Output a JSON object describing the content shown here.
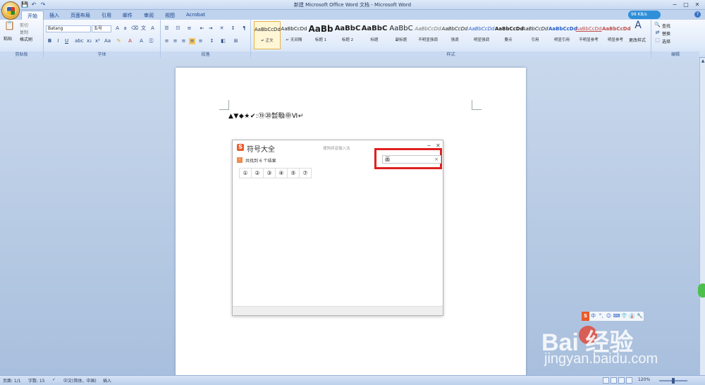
{
  "window": {
    "title": "新建 Microsoft Office Word 文档 - Microsoft Word",
    "qat": [
      "save-icon",
      "undo-icon",
      "redo-icon"
    ],
    "buttons": [
      "─",
      "□",
      "✕"
    ]
  },
  "tabs": [
    "开始",
    "插入",
    "页面布局",
    "引用",
    "邮件",
    "审阅",
    "视图",
    "Acrobat"
  ],
  "network_speed": "98 KB/s",
  "ribbon": {
    "clipboard": {
      "label": "剪贴板",
      "paste": "粘贴",
      "cut": "剪切",
      "copy": "复制",
      "format_painter": "格式刷"
    },
    "font": {
      "label": "字体",
      "name": "Batang",
      "size": "五号"
    },
    "paragraph": {
      "label": "段落"
    },
    "styles": {
      "label": "样式",
      "items": [
        {
          "preview": "AaBbCcDd",
          "name": "↵ 正文"
        },
        {
          "preview": "AaBbCcDd",
          "name": "↵ 无间隔"
        },
        {
          "preview": "AaBb",
          "name": "标题 1"
        },
        {
          "preview": "AaBbC",
          "name": "标题 2"
        },
        {
          "preview": "AaBbC",
          "name": "标题"
        },
        {
          "preview": "AaBbC",
          "name": "副标题"
        },
        {
          "preview": "AaBbCcDd",
          "name": "不明显强调"
        },
        {
          "preview": "AaBbCcDd",
          "name": "强调"
        },
        {
          "preview": "AaBbCcDd",
          "name": "明显强调"
        },
        {
          "preview": "AaBbCcDd",
          "name": "要点"
        },
        {
          "preview": "AaBbCcDd",
          "name": "引用"
        },
        {
          "preview": "AaBbCcDd",
          "name": "明显引用"
        },
        {
          "preview": "AaBbCcDd",
          "name": "不明显参考"
        },
        {
          "preview": "AaBbCcDd",
          "name": "明显参考"
        }
      ],
      "change": "更改样式"
    },
    "editing": {
      "label": "编辑",
      "find": "查找",
      "replace": "替换",
      "select": "选择"
    }
  },
  "document": {
    "text": "▲▼◆★✔:⑲⑳㍿㍾㊥Ⅵ↵"
  },
  "dialog": {
    "title": "符号大全",
    "subtitle": "搜狗拼音输入法",
    "result_text": "共找到 6 个结果",
    "search_value": "画",
    "results": [
      "①",
      "②",
      "③",
      "④",
      "⑤",
      "⑦"
    ]
  },
  "ime_items": [
    "S",
    "中",
    "°,",
    "☺",
    "⌨",
    "👕",
    "👔",
    "🔧"
  ],
  "watermark": {
    "brand": "Bai  经验",
    "url": "jingyan.baidu.com"
  },
  "status": {
    "page": "页面: 1/1",
    "words": "字数: 15",
    "language": "中文(简体，中国)",
    "mode": "插入",
    "zoom": "120%"
  }
}
